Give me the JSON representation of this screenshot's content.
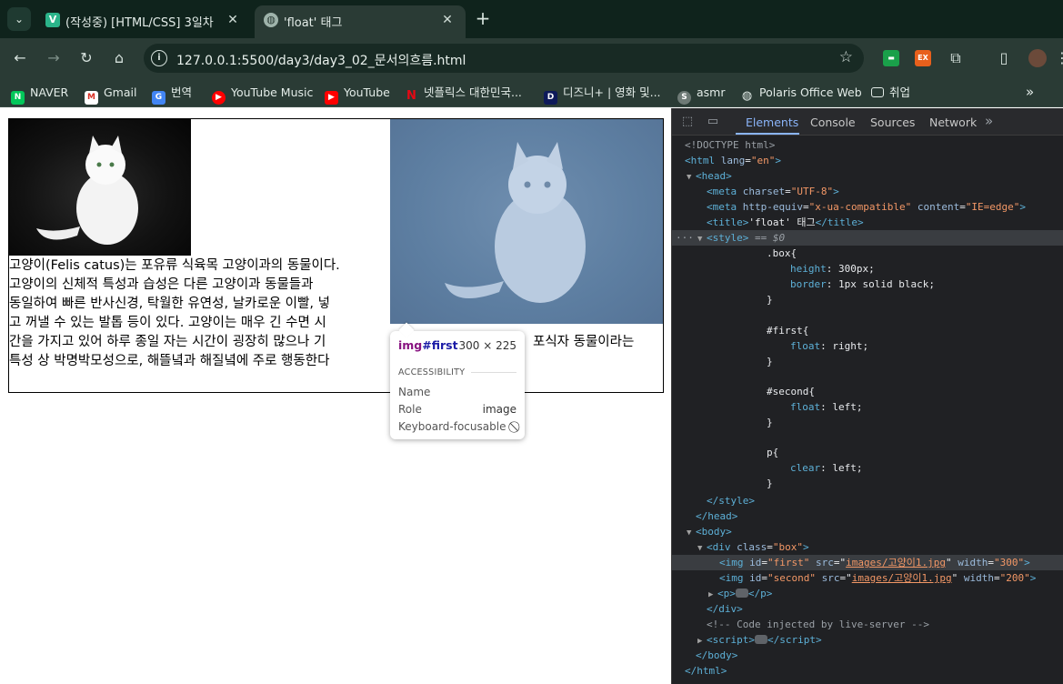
{
  "browser": {
    "tabs": [
      {
        "title": "(작성중) [HTML/CSS] 3일차",
        "favicon": "V",
        "active": false
      },
      {
        "title": "'float' 태그",
        "favicon": "globe",
        "active": true
      }
    ],
    "url": "127.0.0.1:5500/day3/day3_02_문서의흐름.html",
    "bookmarks": [
      "NAVER",
      "Gmail",
      "번역",
      "YouTube Music",
      "YouTube",
      "넷플릭스 대한민국...",
      "디즈니+ | 영화 및...",
      "asmr",
      "Polaris Office Web",
      "취업"
    ],
    "colors": {
      "chrome_bg": "#2a3b35",
      "tabstrip_bg": "#0f231c"
    }
  },
  "page": {
    "paragraph_lines": [
      "고양이(Felis catus)는 포유류 식육목 고양이과의 동물이다.",
      "고양이의 신체적 특성과 습성은 다른 고양이과 동물들과",
      "동일하여 빠른 반사신경, 탁월한 유연성, 날카로운 이빨, 넣",
      "고 꺼낼 수 있는 발톱 등이 있다. 고양이는 매우 긴 수면 시",
      "간을 가지고 있어 하루 종일 자는 시간이 굉장히 많으나 기",
      "특성 상 박명박모성으로, 해뜰녘과 해질녘에 주로 행동한다"
    ],
    "paragraph_tail_visible": "포식자 동물이라는",
    "highlight_color": "#6a8ab0"
  },
  "tooltip": {
    "tag": "img",
    "id": "#first",
    "size": "300 × 225",
    "section": "ACCESSIBILITY",
    "rows": [
      {
        "label": "Name",
        "value": ""
      },
      {
        "label": "Role",
        "value": "image"
      },
      {
        "label": "Keyboard-focusable",
        "value": "⃠"
      }
    ]
  },
  "devtools": {
    "tabs": [
      "Elements",
      "Console",
      "Sources",
      "Network"
    ],
    "more": "»",
    "active_tab": "Elements",
    "code": {
      "doctype": "<!DOCTYPE html>",
      "html_open": "<html",
      "lang_attr": "lang",
      "lang_val": "\"en\"",
      "head": "head",
      "meta1_attr": "charset",
      "meta1_val": "\"UTF-8\"",
      "meta2_attr1": "http-equiv",
      "meta2_val1": "\"x-ua-compatible\"",
      "meta2_attr2": "content",
      "meta2_val2": "\"IE=edge\"",
      "title_text": "'float' 태그",
      "style_eq": "== $0",
      "css_box_sel": ".box{",
      "css_box_p1": "height",
      "css_box_v1": "300px;",
      "css_box_p2": "border",
      "css_box_v2": "1px solid black;",
      "css_first_sel": "#first{",
      "css_first_p": "float",
      "css_first_v": "right;",
      "css_second_sel": "#second{",
      "css_second_p": "float",
      "css_second_v": "left;",
      "css_p_sel": "p{",
      "css_p_p": "clear",
      "css_p_v": "left;",
      "div_attr": "class",
      "div_val": "\"box\"",
      "img1_id": "\"first\"",
      "img1_src": "images/고양이1.jpg",
      "img1_w": "\"300\"",
      "img2_id": "\"second\"",
      "img2_src": "images/고양이1.jpg",
      "img2_w": "\"200\"",
      "comment": "<!-- Code injected by live-server -->"
    }
  }
}
